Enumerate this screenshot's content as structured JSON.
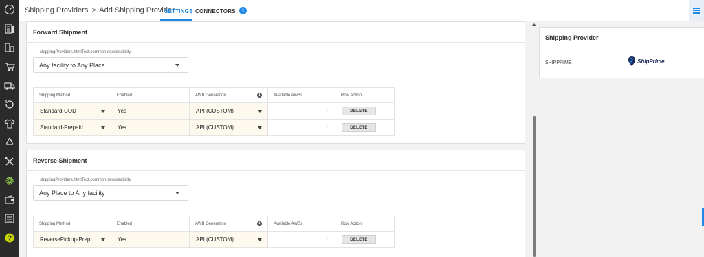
{
  "header": {
    "breadcrumb_parent": "Shipping Providers",
    "breadcrumb_separator": ">",
    "breadcrumb_current": "Add Shipping Provider",
    "tabs": [
      {
        "label": "SETTINGS",
        "active": true
      },
      {
        "label": "CONNECTORS",
        "active": false
      }
    ],
    "info_icon_glyph": "i"
  },
  "sidebar": {
    "icons": [
      "dashboard-icon",
      "orders-icon",
      "products-icon",
      "cart-icon",
      "shipping-icon",
      "returns-icon",
      "apparel-icon",
      "recycle-icon",
      "tools-icon",
      "settings-gear-icon",
      "wallet-icon",
      "reports-icon",
      "help-icon"
    ],
    "active_color": "#8bc34a"
  },
  "forward": {
    "title": "Forward Shipment",
    "serviceability_label": "shippingProviders.htmlText.common.serviceability",
    "serviceability_value": "Any facility to Any Place",
    "columns": [
      "Shipping Method",
      "Enabled",
      "AWB Generation",
      "Available AWBs",
      "Row Action"
    ],
    "rows": [
      {
        "method": "Standard-COD",
        "enabled": "Yes",
        "awb": "API (CUSTOM)",
        "available": "-",
        "action": "DELETE"
      },
      {
        "method": "Standard-Prepaid",
        "enabled": "Yes",
        "awb": "API (CUSTOM)",
        "available": "-",
        "action": "DELETE"
      }
    ]
  },
  "reverse": {
    "title": "Reverse Shipment",
    "serviceability_label": "shippingProviders.htmlText.common.serviceability",
    "serviceability_value": "Any Place to Any facility",
    "columns": [
      "Shipping Method",
      "Enabled",
      "AWB Generation",
      "Available AWBs",
      "Row Action"
    ],
    "rows": [
      {
        "method": "ReversePickup-Prep...",
        "enabled": "Yes",
        "awb": "API (CUSTOM)",
        "available": "-",
        "action": "DELETE"
      }
    ]
  },
  "provider_panel": {
    "title": "Shipping Provider",
    "name": "SHIPPRIME",
    "logo_text": "ShipPrime"
  },
  "colors": {
    "accent": "#1e88e5",
    "dropdown_bg": "#fdf9ef",
    "sidebar_bg": "#2b2b2b"
  }
}
